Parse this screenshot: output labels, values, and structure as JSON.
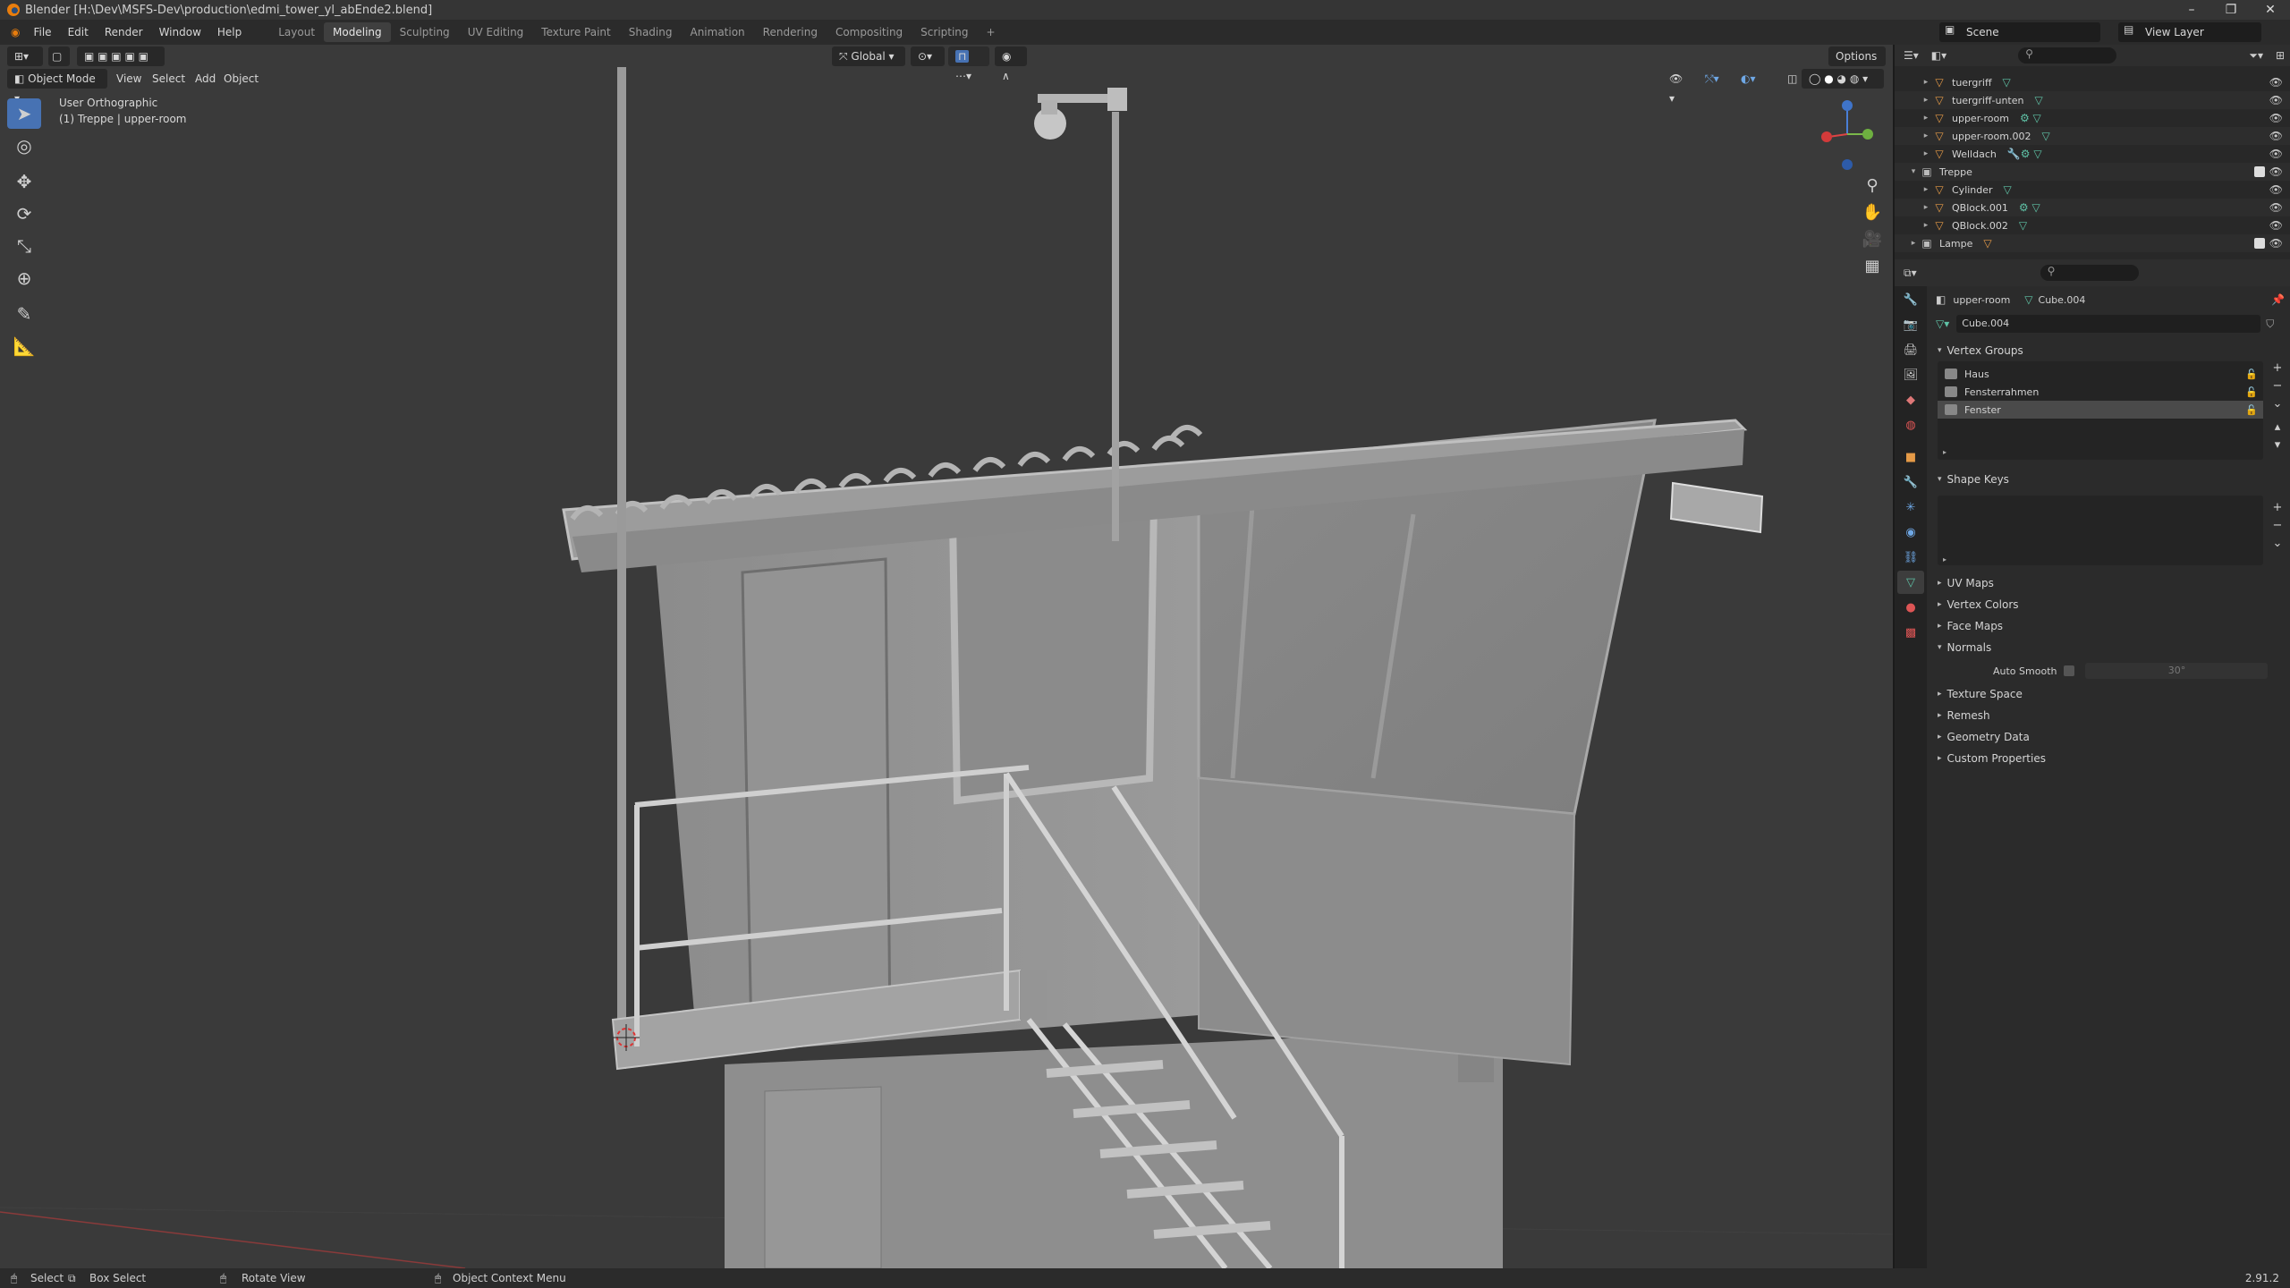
{
  "window": {
    "title": "Blender [H:\\Dev\\MSFS-Dev\\production\\edmi_tower_yl_abEnde2.blend]"
  },
  "menu": [
    "File",
    "Edit",
    "Render",
    "Window",
    "Help"
  ],
  "workspaces": [
    "Layout",
    "Modeling",
    "Sculpting",
    "UV Editing",
    "Texture Paint",
    "Shading",
    "Animation",
    "Rendering",
    "Compositing",
    "Scripting"
  ],
  "scene": {
    "name": "Scene",
    "view_layer": "View Layer"
  },
  "viewport": {
    "mode": "Object Mode",
    "menus": [
      "View",
      "Select",
      "Add",
      "Object"
    ],
    "transform_orientation": "Global",
    "options_label": "Options",
    "view_name": "User Orthographic",
    "view_object": "(1) Treppe | upper-room"
  },
  "outliner": {
    "rows": [
      {
        "name": "tuergriff",
        "indent": 2
      },
      {
        "name": "tuergriff-unten",
        "indent": 2
      },
      {
        "name": "upper-room",
        "indent": 2
      },
      {
        "name": "upper-room.002",
        "indent": 2
      },
      {
        "name": "Welldach",
        "indent": 2
      },
      {
        "name": "Treppe",
        "indent": 1,
        "collection": true
      },
      {
        "name": "Cylinder",
        "indent": 2
      },
      {
        "name": "QBlock.001",
        "indent": 2
      },
      {
        "name": "QBlock.002",
        "indent": 2
      },
      {
        "name": "Lampe",
        "indent": 1,
        "collection": true
      }
    ]
  },
  "properties": {
    "object_name": "upper-room",
    "mesh_name": "Cube.004",
    "mesh_field": "Cube.004",
    "vertex_groups_label": "Vertex Groups",
    "vertex_groups": [
      "Haus",
      "Fensterrahmen",
      "Fenster"
    ],
    "shape_keys_label": "Shape Keys",
    "panels_collapsed_a": [
      "UV Maps",
      "Vertex Colors",
      "Face Maps"
    ],
    "normals_label": "Normals",
    "auto_smooth_label": "Auto Smooth",
    "auto_smooth_angle": "30°",
    "panels_collapsed_b": [
      "Texture Space",
      "Remesh",
      "Geometry Data",
      "Custom Properties"
    ]
  },
  "statusbar": {
    "select": "Select",
    "box_select": "Box Select",
    "rotate_view": "Rotate View",
    "context_menu": "Object Context Menu",
    "version": "2.91.2"
  },
  "colors": {
    "accent": "#4772b3",
    "mesh_icon": "#5fc2a6",
    "object_icon": "#e59a47"
  }
}
